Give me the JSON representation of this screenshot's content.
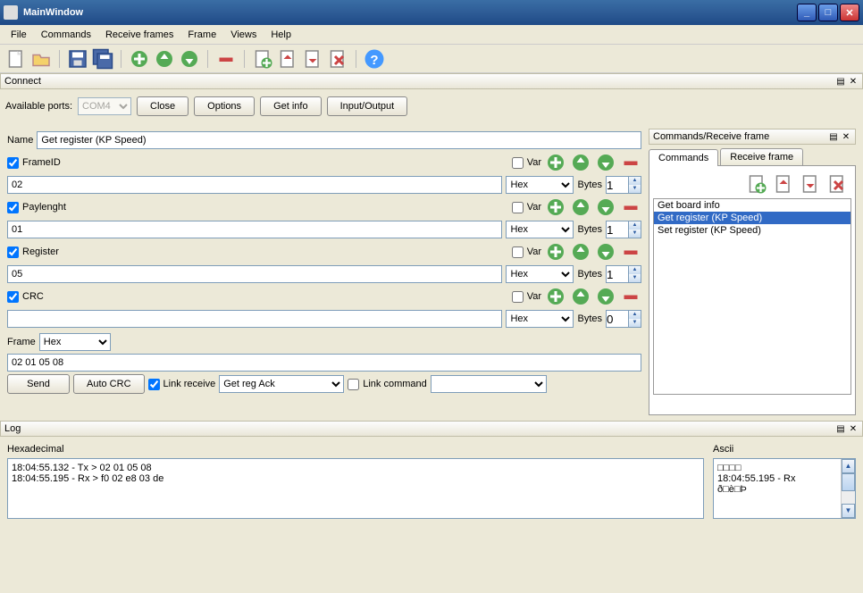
{
  "window": {
    "title": "MainWindow"
  },
  "menu": {
    "items": [
      "File",
      "Commands",
      "Receive frames",
      "Frame",
      "Views",
      "Help"
    ]
  },
  "panels": {
    "connect": {
      "title": "Connect"
    },
    "commands": {
      "title": "Commands/Receive frame"
    },
    "log": {
      "title": "Log"
    }
  },
  "connect": {
    "ports_label": "Available ports:",
    "port": "COM4",
    "close": "Close",
    "options": "Options",
    "getinfo": "Get info",
    "io": "Input/Output"
  },
  "form": {
    "name_label": "Name",
    "name": "Get register (KP Speed)",
    "var": "Var",
    "bytes": "Bytes",
    "format_options": [
      "Hex"
    ],
    "fields": [
      {
        "label": "FrameID",
        "checked": true,
        "value": "02",
        "format": "Hex",
        "bytes": "1",
        "var": false
      },
      {
        "label": "Paylenght",
        "checked": true,
        "value": "01",
        "format": "Hex",
        "bytes": "1",
        "var": false
      },
      {
        "label": "Register",
        "checked": true,
        "value": "05",
        "format": "Hex",
        "bytes": "1",
        "var": false
      },
      {
        "label": "CRC",
        "checked": true,
        "value": "",
        "format": "Hex",
        "bytes": "0",
        "var": false
      }
    ],
    "frame_label": "Frame",
    "frame_format": "Hex",
    "frame_value": "02 01 05 08",
    "send": "Send",
    "autocrc": "Auto CRC",
    "link_receive": "Link receive",
    "link_receive_value": "Get reg Ack",
    "link_command": "Link command"
  },
  "cmds": {
    "tab_commands": "Commands",
    "tab_receive": "Receive frame",
    "items": [
      "Get board info",
      "Get register (KP Speed)",
      "Set register (KP Speed)"
    ],
    "selected": 1
  },
  "log": {
    "hex_label": "Hexadecimal",
    "ascii_label": "Ascii",
    "hex_lines": [
      "18:04:55.132 - Tx > 02 01 05 08",
      "18:04:55.195 - Rx > f0 02 e8 03 de"
    ],
    "ascii_lines": [
      "□□□□",
      "18:04:55.195 - Rx",
      "ð□è□Þ"
    ]
  }
}
